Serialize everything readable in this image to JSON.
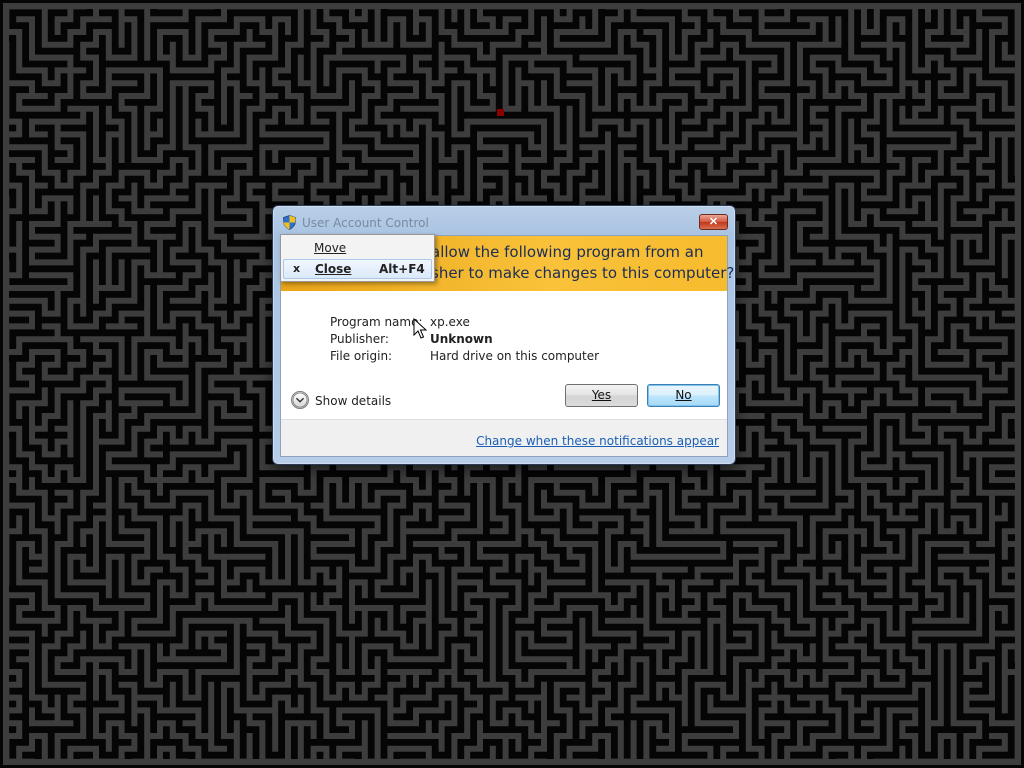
{
  "dialog": {
    "title": "User Account Control",
    "banner_line1": "allow the following program from an",
    "banner_line2": "sher to make changes to this computer?",
    "program_name_label": "Program name:",
    "program_name_value": "xp.exe",
    "publisher_label": "Publisher:",
    "publisher_value": "Unknown",
    "file_origin_label": "File origin:",
    "file_origin_value": "Hard drive on this computer",
    "show_details_label": "Show details",
    "yes_label": "Yes",
    "no_label": "No",
    "change_link": "Change when these notifications appear",
    "close_glyph": "✕"
  },
  "system_menu": {
    "move_label": "Move",
    "close_label": "Close",
    "close_shortcut": "Alt+F4",
    "close_icon": "x"
  },
  "colors": {
    "banner": "#f4b61f",
    "maze_wall": "#3d3d3d",
    "maze_bg": "#050505",
    "maze_marker": "#8b0000",
    "link": "#1a5fb4"
  },
  "icons": {
    "title": "uac-shield-icon",
    "close": "close-icon",
    "chevron": "chevron-down-icon",
    "cursor": "mouse-pointer-icon"
  }
}
